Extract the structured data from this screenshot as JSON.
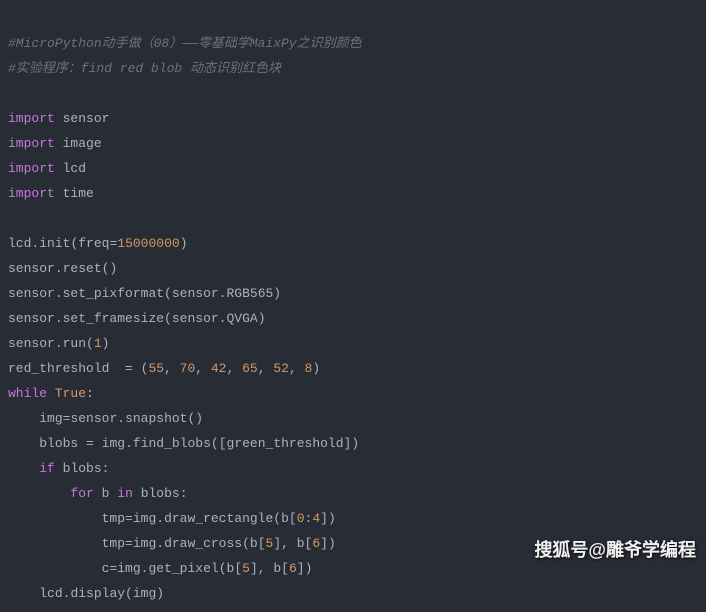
{
  "code": {
    "line1_comment": "#MicroPython动手做（08）——零基础学MaixPy之识别颜色",
    "line2_comment": "#实验程序：find red blob 动态识别红色块",
    "import_kw": "import",
    "mod_sensor": "sensor",
    "mod_image": "image",
    "mod_lcd": "lcd",
    "mod_time": "time",
    "lcd": "lcd",
    "init": "init",
    "freq_param": "freq",
    "freq_val": "15000000",
    "sensor": "sensor",
    "reset": "reset",
    "set_pixformat": "set_pixformat",
    "RGB565": "RGB565",
    "set_framesize": "set_framesize",
    "QVGA": "QVGA",
    "run": "run",
    "run_val": "1",
    "red_threshold": "red_threshold",
    "t1": "55",
    "t2": "70",
    "t3": "42",
    "t4": "65",
    "t5": "52",
    "t6": "8",
    "while_kw": "while",
    "true_kw": "True",
    "img": "img",
    "snapshot": "snapshot",
    "blobs": "blobs",
    "find_blobs": "find_blobs",
    "green_threshold": "green_threshold",
    "if_kw": "if",
    "for_kw": "for",
    "b": "b",
    "in_kw": "in",
    "tmp": "tmp",
    "draw_rectangle": "draw_rectangle",
    "idx0": "0",
    "idx4": "4",
    "draw_cross": "draw_cross",
    "idx5": "5",
    "idx6": "6",
    "c": "c",
    "get_pixel": "get_pixel",
    "display": "display"
  },
  "watermark": "搜狐号@雕爷学编程"
}
